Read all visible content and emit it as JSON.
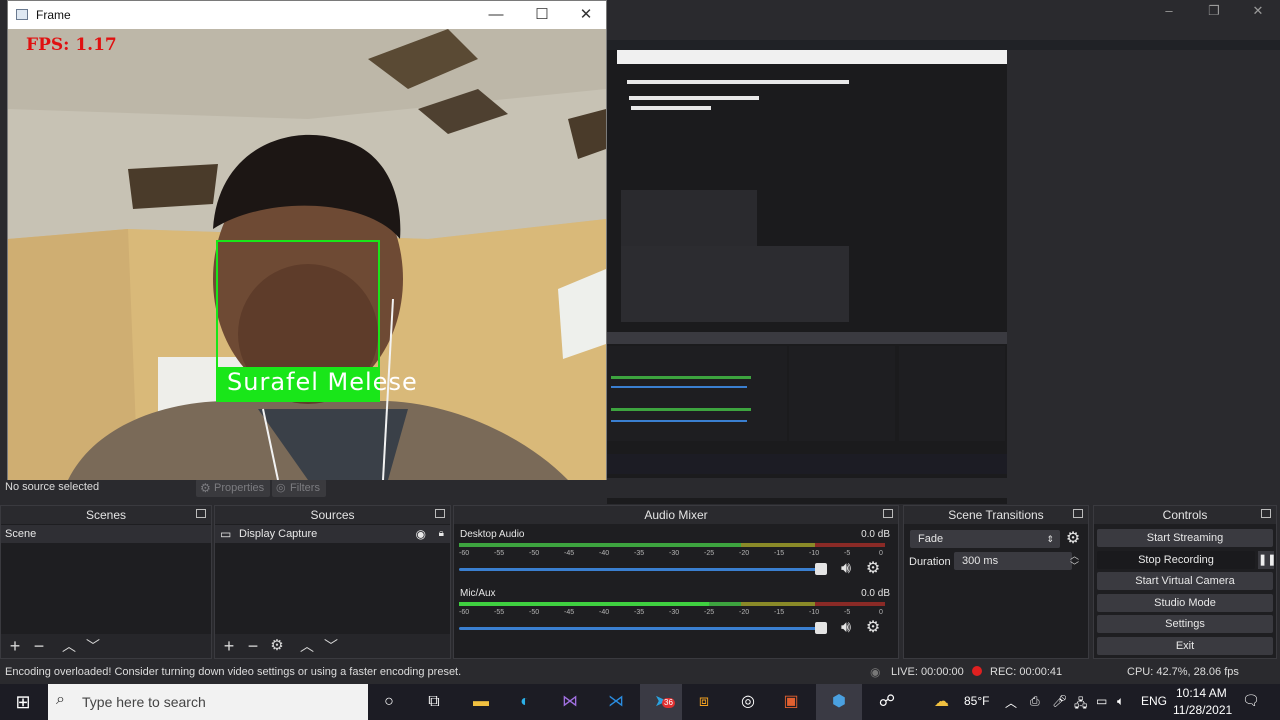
{
  "frame_window": {
    "title": "Frame",
    "fps_text": "FPS: 1.17",
    "face_label": "Surafel Melese"
  },
  "obs": {
    "no_source": "No source selected",
    "properties_label": "Properties",
    "filters_label": "Filters",
    "scenes": {
      "title": "Scenes",
      "items": [
        "Scene"
      ]
    },
    "sources": {
      "title": "Sources",
      "items": [
        "Display Capture"
      ]
    },
    "audio_mixer": {
      "title": "Audio Mixer",
      "channels": [
        {
          "name": "Desktop Audio",
          "db": "0.0 dB"
        },
        {
          "name": "Mic/Aux",
          "db": "0.0 dB"
        }
      ],
      "tick_labels": [
        "-60",
        "-55",
        "-50",
        "-45",
        "-40",
        "-35",
        "-30",
        "-25",
        "-20",
        "-15",
        "-10",
        "-5",
        "0"
      ]
    },
    "scene_transitions": {
      "title": "Scene Transitions",
      "transition": "Fade",
      "duration_label": "Duration",
      "duration_value": "300 ms"
    },
    "controls": {
      "title": "Controls",
      "buttons": [
        "Start Streaming",
        "Stop Recording",
        "Start Virtual Camera",
        "Studio Mode",
        "Settings",
        "Exit"
      ]
    },
    "status": {
      "message": "Encoding overloaded! Consider turning down video settings or using a faster encoding preset.",
      "live": "LIVE: 00:00:00",
      "rec": "REC: 00:00:41",
      "cpu": "CPU: 42.7%, 28.06 fps"
    }
  },
  "taskbar": {
    "search_placeholder": "Type here to search",
    "weather": "85°F",
    "language": "ENG",
    "time": "10:14 AM",
    "date": "11/28/2021",
    "telegram_badge": "36"
  },
  "colors": {
    "face_box": "#19e619",
    "fps_text": "#e01010",
    "record_dot": "#e02020",
    "meter_green": "#3da43f"
  }
}
